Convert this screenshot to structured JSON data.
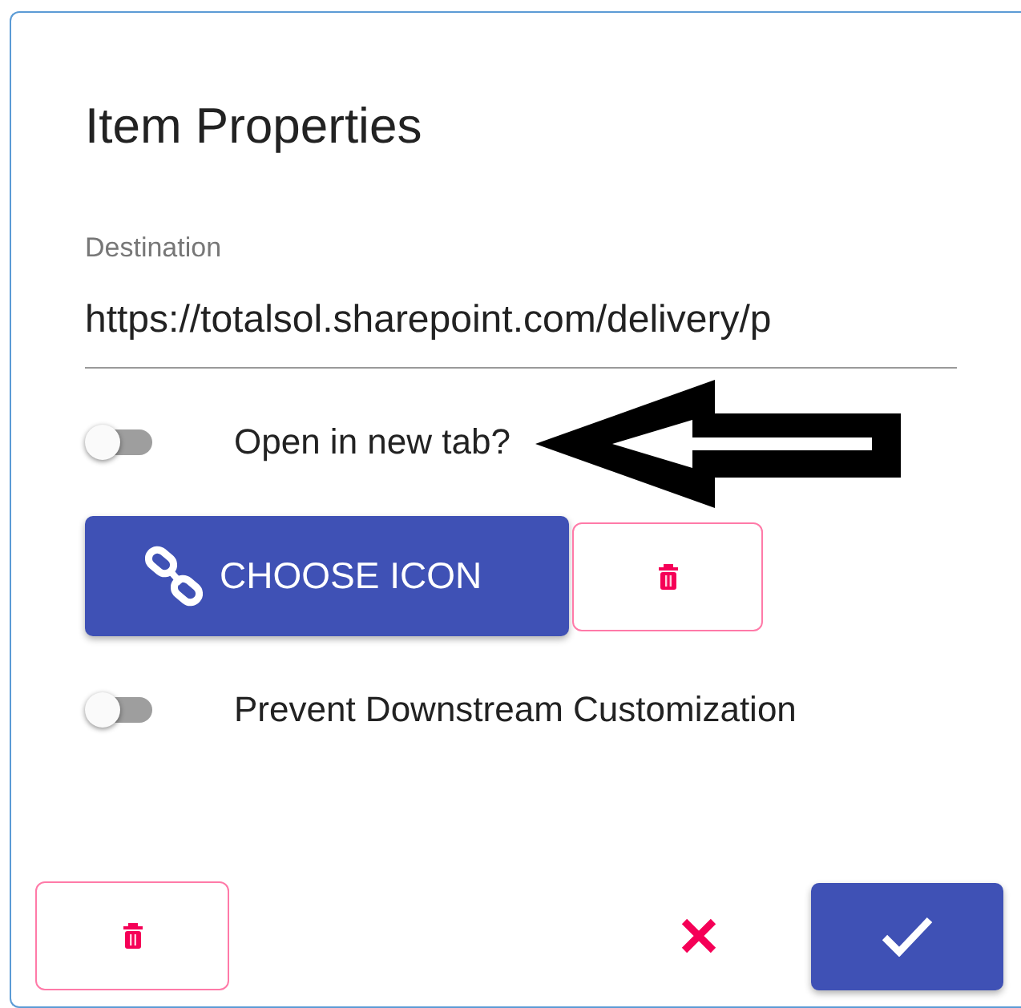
{
  "dialog": {
    "title": "Item Properties"
  },
  "destination": {
    "label": "Destination",
    "value": "https://totalsol.sharepoint.com/delivery/p"
  },
  "toggles": [
    {
      "label": "Open in new tab?",
      "on": false,
      "annotation_arrow": true
    },
    {
      "label": "Prevent Downstream Customization",
      "on": false,
      "annotation_arrow": false
    }
  ],
  "choose_icon_button": {
    "label": "CHOOSE ICON"
  }
}
